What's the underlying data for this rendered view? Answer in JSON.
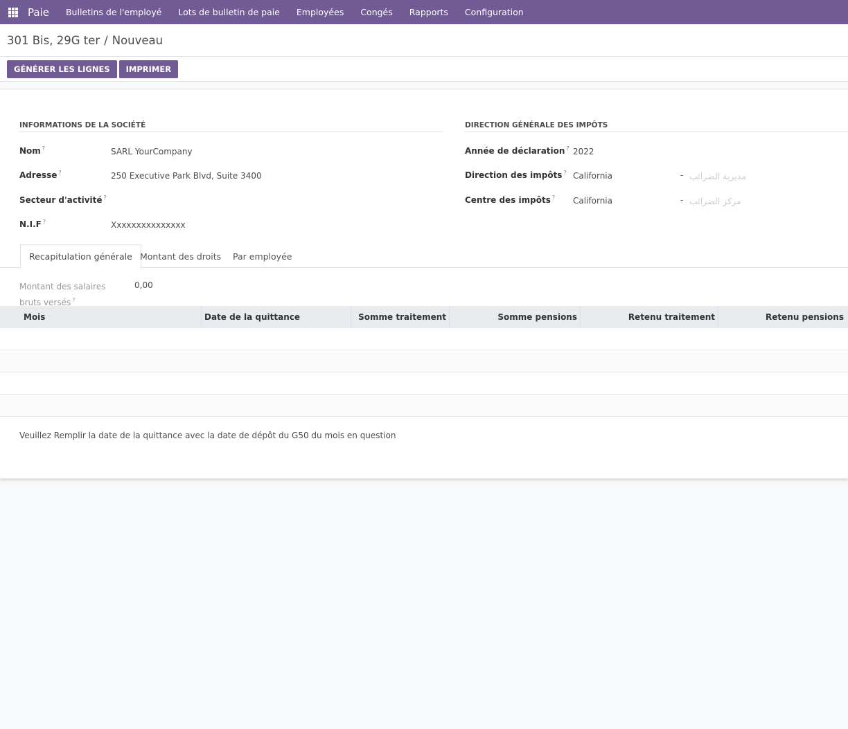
{
  "app": {
    "brand": "Paie",
    "menu": [
      "Bulletins de l'employé",
      "Lots de bulletin de paie",
      "Employées",
      "Congés",
      "Rapports",
      "Configuration"
    ]
  },
  "breadcrumb": {
    "parent": "301 Bis, 29G ter",
    "separator": "/",
    "current": "Nouveau"
  },
  "toolbar": {
    "generate_label": "GÉNÉRER LES LIGNES",
    "print_label": "IMPRIMER"
  },
  "company": {
    "title": "INFORMATIONS DE LA SOCIÉTÉ",
    "fields": [
      {
        "label": "Nom",
        "value": "SARL YourCompany"
      },
      {
        "label": "Adresse",
        "value": "250 Executive Park Blvd, Suite 3400"
      },
      {
        "label": "Secteur d'activité",
        "value": ""
      },
      {
        "label": "N.I.F",
        "value": "Xxxxxxxxxxxxxxx"
      }
    ]
  },
  "tax": {
    "title": "DIRECTION GÉNÉRALE DES IMPÔTS",
    "fields": [
      {
        "label": "Année de déclaration",
        "value": "2022",
        "arabic": ""
      },
      {
        "label": "Direction des impôts",
        "value": "California",
        "dash": "-",
        "arabic": "مديرية الضرائب"
      },
      {
        "label": "Centre des impôts",
        "value": "California",
        "dash": "-",
        "arabic": "مركز الضرائب"
      }
    ]
  },
  "help_mark": "?",
  "tabs": [
    {
      "label": "Recapitulation générale",
      "active": true
    },
    {
      "label": "Montant des droits",
      "active": false
    },
    {
      "label": "Par employée",
      "active": false
    }
  ],
  "summary": {
    "label": "Montant des salaires bruts versés",
    "value": "0,00"
  },
  "table": {
    "columns": [
      "Mois",
      "Date de la quittance",
      "Somme traitement",
      "Somme pensions",
      "Retenu traitement",
      "Retenu pensions"
    ],
    "rows": [
      [],
      [],
      [],
      []
    ]
  },
  "note": "Veuillez Remplir la date de la quittance avec la date de dépôt du G50 du mois en question"
}
